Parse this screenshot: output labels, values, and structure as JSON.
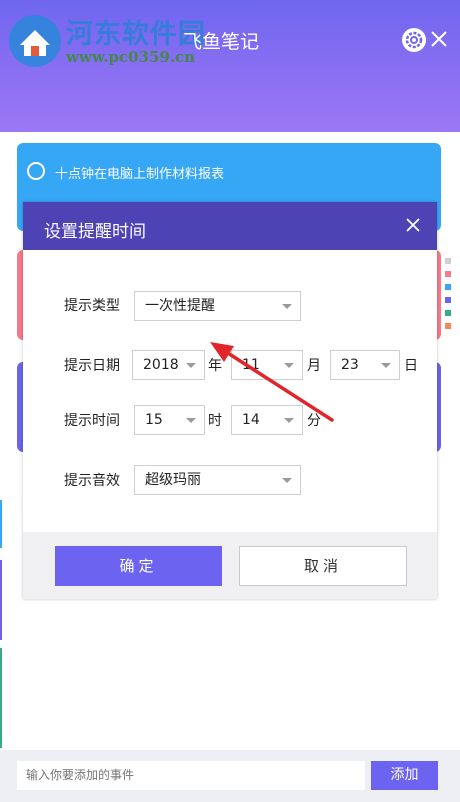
{
  "app": {
    "title": "飞鱼笔记"
  },
  "watermark": {
    "title": "河东软件园",
    "url": "www.pc0359.cn"
  },
  "notes": [
    {
      "text": "十点钟在电脑上制作材料报表",
      "color": "#36a7f4"
    },
    {
      "text": "",
      "color": "#f57a8b"
    },
    {
      "text": "",
      "color": "#6b63e8"
    }
  ],
  "dialog": {
    "title": "设置提醒时间",
    "type": {
      "label": "提示类型",
      "value": "一次性提醒"
    },
    "date": {
      "label": "提示日期",
      "year": "2018",
      "year_unit": "年",
      "month": "11",
      "month_unit": "月",
      "day": "23",
      "day_unit": "日"
    },
    "time": {
      "label": "提示时间",
      "hour": "15",
      "hour_unit": "时",
      "minute": "14",
      "minute_unit": "分"
    },
    "sound": {
      "label": "提示音效",
      "value": "超级玛丽"
    },
    "confirm_label": "确定",
    "cancel_label": "取消"
  },
  "footer": {
    "placeholder": "输入你要添加的事件",
    "add_label": "添加"
  },
  "colors": {
    "accent": "#6c63f0",
    "dialog_header": "#4d43b5",
    "arrow": "#e0262a"
  }
}
